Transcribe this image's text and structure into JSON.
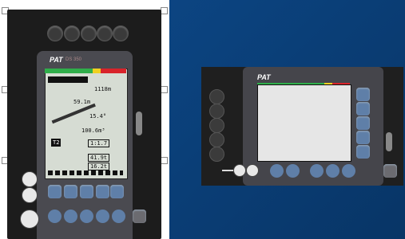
{
  "left_unit": {
    "logo": "PAT",
    "logo_sub": "DS 350",
    "lcd_lines": [
      "1118m",
      "59.1m",
      "15.4°",
      "100.6m³",
      "T2",
      "1:1.7",
      "41.9t",
      "16.2t"
    ],
    "icons": [
      "power-icon",
      "warning-icon",
      "horn-icon"
    ]
  },
  "right_unit": {
    "logo": "PAT"
  },
  "colors": {
    "green": "#2fae4a",
    "yellow": "#f0d020",
    "red": "#d8232a",
    "key_blue": "#5f7fa8"
  }
}
